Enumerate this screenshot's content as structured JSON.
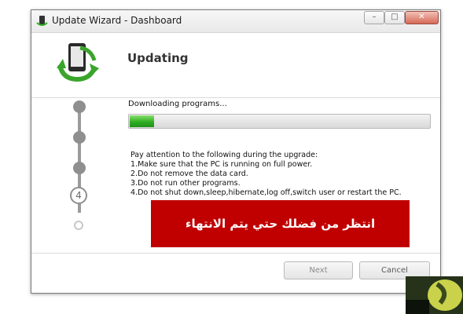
{
  "window": {
    "title": "Update Wizard - Dashboard",
    "controls": {
      "minimize": "–",
      "maximize": "□",
      "close": "✕"
    }
  },
  "header": {
    "title": "Updating",
    "logo_icon": "phone-sync-icon"
  },
  "steps": {
    "current_number": "4",
    "total": 5,
    "completed": 3
  },
  "progress": {
    "status": "Downloading programs...",
    "fraction": 0.08
  },
  "notes": {
    "intro": "Pay attention to the following during the upgrade:",
    "items": [
      "1.Make sure that the PC is running on full power.",
      "2.Do not remove the data card.",
      "3.Do not run other programs.",
      "4.Do not shut down,sleep,hibernate,log off,switch user or restart the PC."
    ]
  },
  "banner": {
    "text": "انتظر من فضلك حتي يتم الانتهاء",
    "color": "#c00000"
  },
  "buttons": {
    "next": "Next",
    "cancel": "Cancel"
  },
  "colors": {
    "progress_fill": "#2fae22",
    "step_color": "#8f8f8f"
  }
}
